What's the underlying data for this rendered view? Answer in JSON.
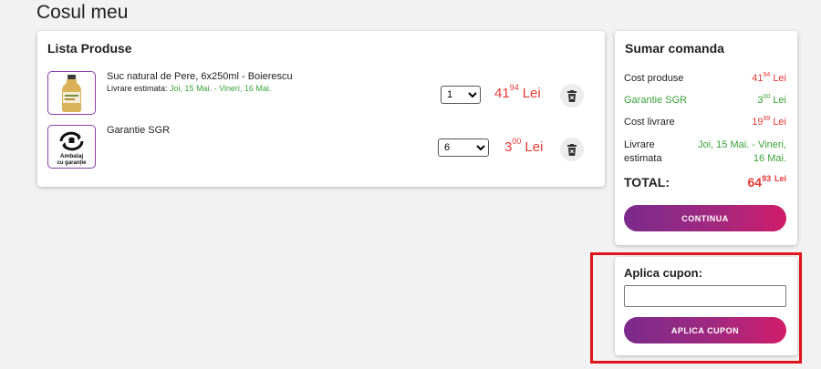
{
  "page": {
    "title": "Cosul meu"
  },
  "products": {
    "title": "Lista Produse",
    "items": [
      {
        "name": "Suc natural de Pere, 6x250ml - Boierescu",
        "delivery_label": "Livrare estimata:",
        "delivery_dates": "Joi, 15 Mai. - Vineri, 16 Mai.",
        "quantity": "1",
        "price_int": "41",
        "price_dec": "94",
        "currency": "Lei"
      },
      {
        "name": "Garantie SGR",
        "thumb_text_line1": "Ambalaj",
        "thumb_text_line2": "cu garanție",
        "quantity": "6",
        "price_int": "3",
        "price_dec": "00",
        "currency": "Lei"
      }
    ]
  },
  "summary": {
    "title": "Sumar comanda",
    "products_label": "Cost produse",
    "products_int": "41",
    "products_dec": "94",
    "sgr_label": "Garantie SGR",
    "sgr_int": "3",
    "sgr_dec": "00",
    "shipping_label": "Cost livrare",
    "shipping_int": "19",
    "shipping_dec": "99",
    "currency": "Lei",
    "delivery_label_1": "Livrare",
    "delivery_label_2": "estimata",
    "delivery_value_1": "Joi, 15 Mai. - Vineri,",
    "delivery_value_2": "16 Mai.",
    "total_label": "TOTAL:",
    "total_int": "64",
    "total_dec": "93",
    "continue_label": "CONTINUA"
  },
  "coupon": {
    "label": "Aplica cupon:",
    "input_value": "",
    "apply_label": "APLICA CUPON"
  },
  "colors": {
    "price_red": "#e53935",
    "delivery_green": "#3aa33a",
    "button_gradient_start": "#7a2a8c",
    "button_gradient_end": "#d01c6a",
    "highlight_red": "#e0141e"
  },
  "icons": [
    "juice-bottle-icon",
    "recycle-deposit-icon",
    "trash-icon"
  ]
}
